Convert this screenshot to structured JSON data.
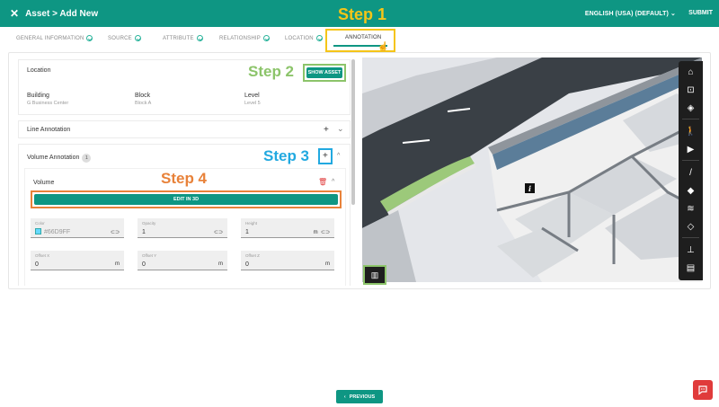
{
  "header": {
    "close_icon": "close-icon",
    "title": "Asset > Add New",
    "language": "ENGLISH (USA) (DEFAULT)",
    "submit": "SUBMIT"
  },
  "steps": {
    "step1": "Step 1",
    "step2": "Step 2",
    "step3": "Step 3",
    "step4": "Step 4"
  },
  "tabs": [
    {
      "label": "GENERAL INFORMATION",
      "done": true
    },
    {
      "label": "SOURCE",
      "done": true
    },
    {
      "label": "ATTRIBUTE",
      "done": true
    },
    {
      "label": "RELATIONSHIP",
      "done": true
    },
    {
      "label": "LOCATION",
      "done": true
    },
    {
      "label": "ANNOTATION",
      "done": false,
      "active": true
    }
  ],
  "location": {
    "title": "Location",
    "show_asset": "SHOW ASSET",
    "building_label": "Building",
    "building_value": "G Business Center",
    "block_label": "Block",
    "block_value": "Block A",
    "level_label": "Level",
    "level_value": "Level 5"
  },
  "line_annotation": {
    "title": "Line Annotation",
    "add": "+",
    "chevron": "⌄"
  },
  "volume_annotation": {
    "title": "Volume Annotation",
    "count": "1",
    "add": "+",
    "chevron": "^"
  },
  "volume": {
    "title": "Volume",
    "edit_3d": "EDIT IN 3D",
    "color_label": "Color",
    "color_value": "#66D9FF",
    "opacity_label": "Opacity",
    "opacity_value": "1",
    "height_label": "Height",
    "height_value": "1",
    "height_unit": "m",
    "offset_x_label": "Offset X",
    "offset_x_value": "0",
    "offset_y_label": "Offset Y",
    "offset_y_value": "0",
    "offset_z_label": "Offset Z",
    "offset_z_value": "0",
    "unit": "m"
  },
  "viewer_tools": [
    "home-icon",
    "focus-icon",
    "fill-icon",
    "walk-icon",
    "camera-icon",
    "measure-icon",
    "section-icon",
    "layers-icon",
    "cube-icon",
    "hierarchy-icon",
    "properties-icon"
  ],
  "footer": {
    "previous": "PREVIOUS"
  },
  "colors": {
    "brand": "#0e9683",
    "step1": "#f5c518",
    "step2": "#8cc46a",
    "step3": "#22a9e0",
    "step4": "#e8823a",
    "swatch": "#66D9FF",
    "chat": "#e03b3b"
  }
}
